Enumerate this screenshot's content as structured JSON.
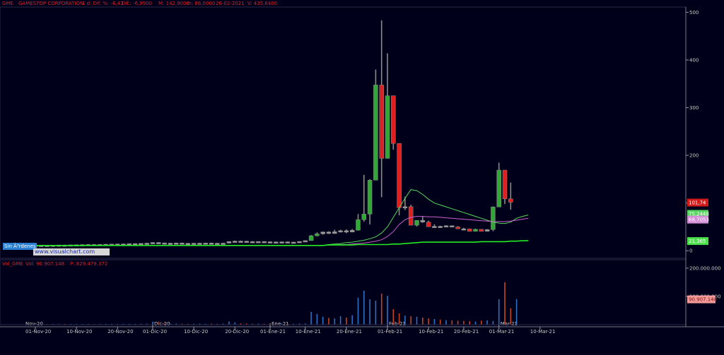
{
  "header": {
    "symbol": "GME",
    "name": "GAMESTOP CORPORATION",
    "change": "1 d. Dif. %: -6,43",
    "diff": "Dif.: -6,9900",
    "max": "M: 142,9000",
    "min": "m: 86,0000",
    "date": "26-02-2021",
    "volume": "V: 435,6400"
  },
  "order_badge": "Sin Ã³rdenes",
  "logo_text": "www.visualchart.com",
  "volume_header": {
    "name": "Vol_GME",
    "vol": "Vol: 90.907.148",
    "p": "P: 829.479.372"
  },
  "colors": {
    "background": "#00001a",
    "up": "#2fa836",
    "down": "#e02020",
    "wick": "#8a8a8a",
    "ma_fast": "#59d65f",
    "ma_mid": "#cc5fcf",
    "ma_slow": "#22ee22",
    "vol_up": "#2a72c4",
    "vol_down": "#c8431c",
    "grid": "#1c1c3a"
  },
  "price_badges": {
    "last": "101,74",
    "ma_fast": "75,2448",
    "ma_mid": "68,7053",
    "ma_slow": "21,365"
  },
  "volume_badge": "90.907.148",
  "chart_data": [
    {
      "type": "candlestick",
      "title": "GME - GAMESTOP CORPORATION",
      "ylim": [
        -10,
        505
      ],
      "yticks": [
        0,
        100,
        200,
        300,
        400,
        500
      ],
      "ytick_labels": [
        "0",
        "100",
        "200",
        "300",
        "400",
        "500"
      ],
      "grid": false,
      "xticks": [
        {
          "i": 0,
          "label": "01-Nov-20"
        },
        {
          "i": 7,
          "label": "10-Nov-20"
        },
        {
          "i": 14,
          "label": "20-Nov-20"
        },
        {
          "i": 20,
          "label": "01-Dic-20"
        },
        {
          "i": 27,
          "label": "10-Dic-20"
        },
        {
          "i": 34,
          "label": "20-Dic-20"
        },
        {
          "i": 40,
          "label": "01-Ene-21"
        },
        {
          "i": 46,
          "label": "10-Ene-21"
        },
        {
          "i": 53,
          "label": "20-Ene-21"
        },
        {
          "i": 60,
          "label": "01-Feb-21"
        },
        {
          "i": 67,
          "label": "10-Feb-21"
        },
        {
          "i": 73,
          "label": "20-Feb-21"
        },
        {
          "i": 79,
          "label": "01-Mar-21"
        },
        {
          "i": 86,
          "label": "10-Mar-21"
        }
      ],
      "month_markers": [
        {
          "i": 20,
          "label": "Dic-20"
        },
        {
          "i": 40,
          "label": "Ene-21"
        },
        {
          "i": 60,
          "label": "Feb-21"
        },
        {
          "i": 79,
          "label": "Mar-21"
        }
      ],
      "first_month_label": "Nov-20",
      "ohlc": [
        [
          10.5,
          11.8,
          10.2,
          11.2
        ],
        [
          11.2,
          12.0,
          10.8,
          11.4
        ],
        [
          11.4,
          12.1,
          11.0,
          11.3
        ],
        [
          11.3,
          11.9,
          10.9,
          11.6
        ],
        [
          11.6,
          12.4,
          11.3,
          12.0
        ],
        [
          12.0,
          12.6,
          11.7,
          11.9
        ],
        [
          11.9,
          12.5,
          11.5,
          12.3
        ],
        [
          12.3,
          13.0,
          12.0,
          12.6
        ],
        [
          12.6,
          13.2,
          12.2,
          12.8
        ],
        [
          12.8,
          13.5,
          12.4,
          13.0
        ],
        [
          13.0,
          13.7,
          12.6,
          12.7
        ],
        [
          12.7,
          13.4,
          12.3,
          13.1
        ],
        [
          13.1,
          13.9,
          12.8,
          13.6
        ],
        [
          13.6,
          14.2,
          13.2,
          13.9
        ],
        [
          13.9,
          14.6,
          13.5,
          14.1
        ],
        [
          14.1,
          14.8,
          13.7,
          14.3
        ],
        [
          14.3,
          15.0,
          13.9,
          14.8
        ],
        [
          14.8,
          15.5,
          14.3,
          15.0
        ],
        [
          15.0,
          15.8,
          14.6,
          15.4
        ],
        [
          15.4,
          16.2,
          15.0,
          15.9
        ],
        [
          15.9,
          17.8,
          15.4,
          17.2
        ],
        [
          17.2,
          17.9,
          15.9,
          16.4
        ],
        [
          16.4,
          16.9,
          15.1,
          15.6
        ],
        [
          15.6,
          16.4,
          14.9,
          15.9
        ],
        [
          15.9,
          16.8,
          15.4,
          16.2
        ],
        [
          16.2,
          16.9,
          15.3,
          15.6
        ],
        [
          15.6,
          16.3,
          14.8,
          15.3
        ],
        [
          15.3,
          16.1,
          14.9,
          15.8
        ],
        [
          15.8,
          16.5,
          15.1,
          15.9
        ],
        [
          15.9,
          16.6,
          15.2,
          16.1
        ],
        [
          16.1,
          16.8,
          15.4,
          15.8
        ],
        [
          15.8,
          16.4,
          15.0,
          15.4
        ],
        [
          15.4,
          16.2,
          15.0,
          15.9
        ],
        [
          15.9,
          19.5,
          15.7,
          19.3
        ],
        [
          19.3,
          21.0,
          18.5,
          20.2
        ],
        [
          20.2,
          21.2,
          19.3,
          20.0
        ],
        [
          20.0,
          20.8,
          18.9,
          19.2
        ],
        [
          19.2,
          20.0,
          18.4,
          18.9
        ],
        [
          18.9,
          19.8,
          18.2,
          19.3
        ],
        [
          19.3,
          20.0,
          18.6,
          18.8
        ],
        [
          18.8,
          19.5,
          17.9,
          18.4
        ],
        [
          18.4,
          19.2,
          17.6,
          17.3
        ],
        [
          17.3,
          18.9,
          17.1,
          18.7
        ],
        [
          18.7,
          19.3,
          17.8,
          17.9
        ],
        [
          17.9,
          18.6,
          17.2,
          18.1
        ],
        [
          18.1,
          19.8,
          17.9,
          19.4
        ],
        [
          19.4,
          21.5,
          18.9,
          21.2
        ],
        [
          21.2,
          33.0,
          21.0,
          31.4
        ],
        [
          31.4,
          38.6,
          30.1,
          35.5
        ],
        [
          35.5,
          40.0,
          33.6,
          39.4
        ],
        [
          39.4,
          40.7,
          35.1,
          36.0
        ],
        [
          36.0,
          44.1,
          35.5,
          39.8
        ],
        [
          39.8,
          43.9,
          38.3,
          42.0
        ],
        [
          42.0,
          44.6,
          36.6,
          39.1
        ],
        [
          39.1,
          45.5,
          38.7,
          43.0
        ],
        [
          43.0,
          76.8,
          42.3,
          65.0
        ],
        [
          65.0,
          159.0,
          61.1,
          76.8
        ],
        [
          76.8,
          150.0,
          55.0,
          147.9
        ],
        [
          147.9,
          380.0,
          249.0,
          347.5
        ],
        [
          347.5,
          483.0,
          112.3,
          193.6
        ],
        [
          193.6,
          413.9,
          250.0,
          325.0
        ],
        [
          325.0,
          322.0,
          212.0,
          225.0
        ],
        [
          225.0,
          158.0,
          74.2,
          90.0
        ],
        [
          90.0,
          113.4,
          85.3,
          92.4
        ],
        [
          92.4,
          96.3,
          53.3,
          53.5
        ],
        [
          53.5,
          60.0,
          50.8,
          63.8
        ],
        [
          63.8,
          72.7,
          58.6,
          60.0
        ],
        [
          60.0,
          62.9,
          54.5,
          50.3
        ],
        [
          50.3,
          55.6,
          49.5,
          51.2
        ],
        [
          51.2,
          52.4,
          49.0,
          51.1
        ],
        [
          51.1,
          53.3,
          50.0,
          52.4
        ],
        [
          52.4,
          52.5,
          49.8,
          50.0
        ],
        [
          50.0,
          51.4,
          47.1,
          46.0
        ],
        [
          46.0,
          48.0,
          43.4,
          45.9
        ],
        [
          45.9,
          46.4,
          40.0,
          40.6
        ],
        [
          40.6,
          46.5,
          40.6,
          44.9
        ],
        [
          44.9,
          45.5,
          41.3,
          40.6
        ],
        [
          40.6,
          45.3,
          40.6,
          44.5
        ],
        [
          44.5,
          93.0,
          41.0,
          91.7
        ],
        [
          91.7,
          184.7,
          108.7,
          169.0
        ],
        [
          169.0,
          132.0,
          97.8,
          108.7
        ],
        [
          108.7,
          142.9,
          86.0,
          101.7
        ]
      ],
      "series": [
        {
          "name": "ma_fast",
          "values": [
            11,
            11,
            11,
            11,
            11,
            11,
            11,
            11,
            11,
            11,
            11,
            11,
            11,
            11,
            11,
            11,
            11,
            11,
            11,
            11,
            11,
            11,
            11,
            11,
            11,
            11,
            11,
            11,
            11,
            11,
            11,
            11,
            11,
            11,
            11,
            11,
            11,
            11,
            11,
            11,
            11,
            11,
            11,
            11,
            11,
            11,
            11,
            11,
            11,
            11,
            13,
            14,
            15,
            17,
            18,
            20,
            22,
            25,
            29,
            37,
            50,
            70,
            90,
            110,
            128,
            126,
            118,
            108,
            100,
            96,
            92,
            88,
            84,
            80,
            76,
            72,
            68,
            64,
            60,
            58,
            57,
            60,
            68,
            72,
            75
          ]
        },
        {
          "name": "ma_mid",
          "values": [
            11,
            11,
            11,
            11,
            11,
            11,
            11,
            11,
            11,
            11,
            11,
            11,
            11,
            11,
            11,
            11,
            11,
            11,
            11,
            11,
            11,
            11,
            11,
            11,
            11,
            11,
            11,
            11,
            11,
            11,
            11,
            11,
            11,
            11,
            11,
            11,
            11,
            11,
            11,
            11,
            11,
            11,
            11,
            11,
            11,
            11,
            11,
            11,
            11,
            11,
            12,
            12,
            13,
            13,
            14,
            15,
            16,
            18,
            20,
            23,
            30,
            40,
            55,
            65,
            70,
            72,
            72,
            71,
            71,
            70,
            69,
            68,
            67,
            66,
            65,
            64,
            63,
            62,
            61,
            61,
            61,
            62,
            64,
            66,
            68
          ]
        },
        {
          "name": "ma_slow",
          "values": [
            11,
            11,
            11,
            11,
            11,
            11,
            11,
            11,
            11,
            11,
            11,
            11,
            11,
            11,
            11,
            11,
            11,
            11,
            11,
            11,
            11,
            11,
            11,
            11,
            11,
            11,
            11,
            11,
            11,
            11,
            11,
            11,
            11,
            11,
            11,
            11,
            11,
            11,
            11,
            11,
            11,
            11,
            11,
            11,
            11,
            11,
            11,
            11,
            11,
            11,
            12,
            12,
            12,
            12,
            12,
            13,
            13,
            13,
            13,
            13,
            13,
            14,
            14,
            15,
            16,
            17,
            18,
            18,
            18,
            18,
            18,
            18,
            18,
            18,
            18,
            18,
            19,
            19,
            19,
            19,
            19,
            20,
            20,
            21,
            21
          ]
        }
      ]
    },
    {
      "type": "bar",
      "title": "Vol_GME",
      "ylim": [
        0,
        200000000
      ],
      "yticks": [
        0,
        100000000,
        200000000
      ],
      "ytick_labels": [
        "0",
        "100.000.000",
        "200.000.000"
      ],
      "values": [
        2.1,
        2.3,
        2.0,
        2.4,
        2.2,
        2.5,
        2.3,
        2.1,
        2.4,
        2.6,
        2.2,
        2.3,
        2.5,
        2.7,
        2.4,
        2.8,
        3.0,
        2.6,
        2.9,
        3.2,
        10.5,
        8.2,
        4.1,
        3.5,
        3.9,
        3.2,
        2.8,
        3.1,
        3.4,
        2.9,
        3.3,
        3.0,
        3.6,
        11.2,
        7.4,
        4.6,
        3.8,
        3.2,
        3.5,
        3.1,
        3.0,
        2.8,
        3.3,
        2.9,
        3.1,
        3.8,
        4.2,
        45.0,
        38.0,
        28.0,
        24.0,
        22.0,
        30.0,
        25.0,
        33.0,
        95.0,
        120.0,
        90.0,
        85.0,
        110.0,
        102.0,
        55.0,
        40.0,
        32.0,
        30.0,
        28.0,
        25.0,
        22.0,
        20.0,
        18.0,
        16.0,
        15.0,
        14.0,
        13.0,
        12.0,
        11.0,
        14.0,
        15.0,
        13.0,
        90.0,
        150.0,
        58.0,
        90.9
      ],
      "value_unit_note": "values in millions of shares"
    }
  ]
}
